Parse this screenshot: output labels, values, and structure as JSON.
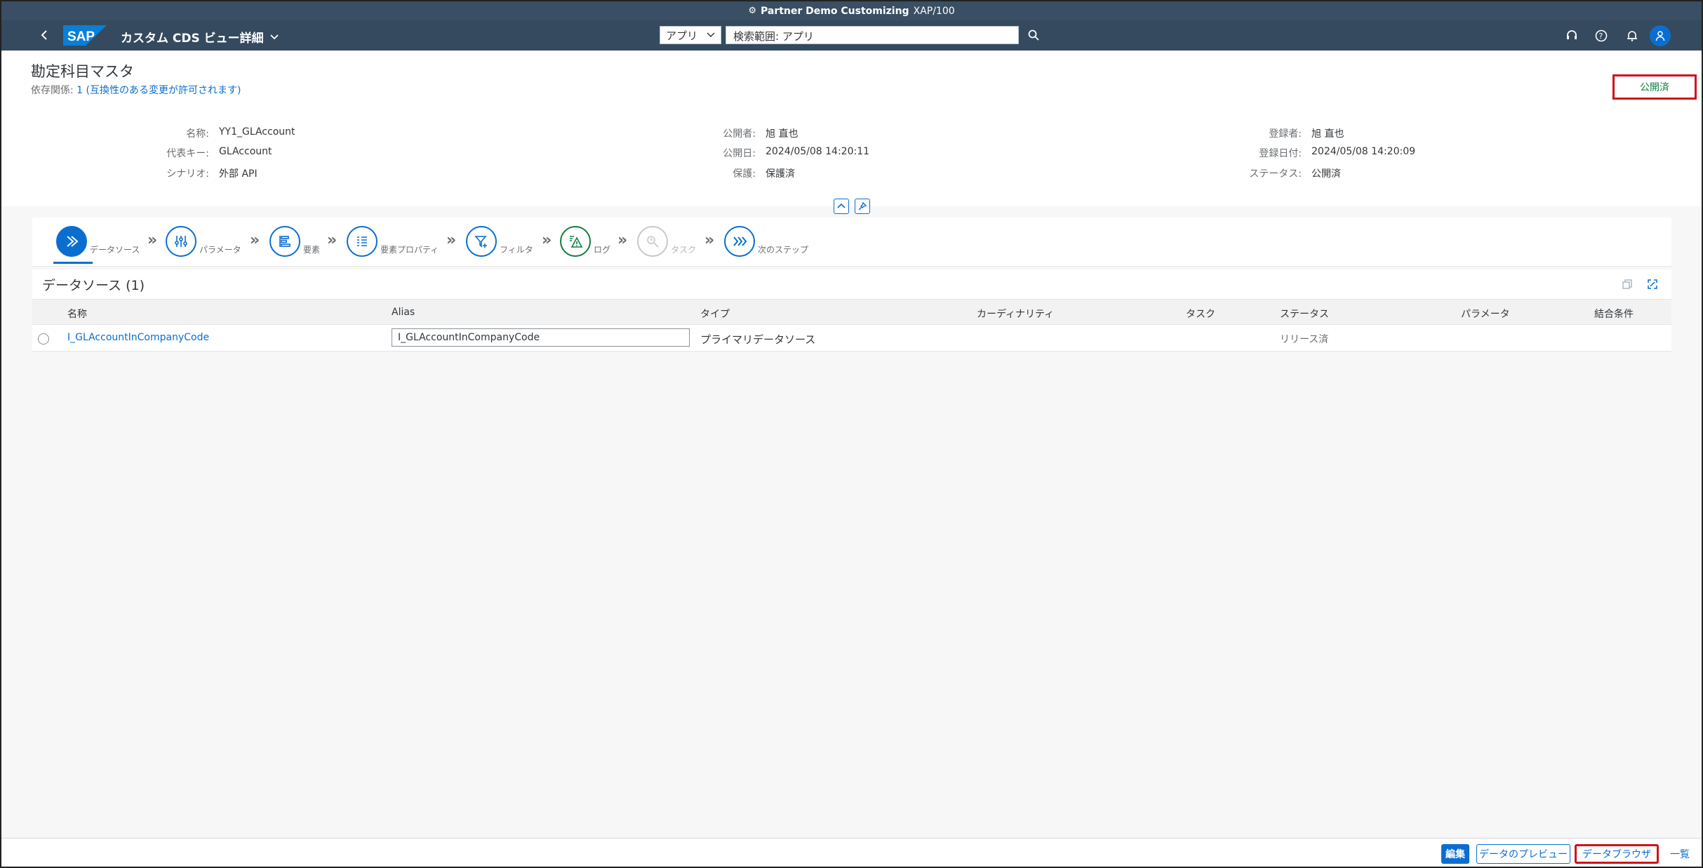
{
  "window": {
    "title_app": "Partner Demo Customizing",
    "title_system": "XAP/100"
  },
  "shell": {
    "back_label": "<",
    "logo": "SAP",
    "title": "カスタム CDS ビュー詳細",
    "scope": "アプリ",
    "search_placeholder": "検索範囲: アプリ"
  },
  "header": {
    "title": "勘定科目マスタ",
    "deps_label": "依存関係:",
    "deps_value": "1 (互換性のある変更が許可されます)",
    "status": "公開済",
    "attributes": {
      "name_label": "名称:",
      "name": "YY1_GLAccount",
      "key_label": "代表キー:",
      "key": "GLAccount",
      "scenario_label": "シナリオ:",
      "scenario": "外部 API",
      "publisher_label": "公開者:",
      "publisher": "旭 直也",
      "pubdate_label": "公開日:",
      "pubdate": "2024/05/08 14:20:11",
      "protection_label": "保護:",
      "protection": "保護済",
      "creator_label": "登録者:",
      "creator": "旭 直也",
      "createdate_label": "登録日付:",
      "createdate": "2024/05/08 14:20:09",
      "status_label": "ステータス:",
      "status_value": "公開済"
    }
  },
  "steps": [
    {
      "label": "データソース",
      "icon": "data-source-icon",
      "state": "active"
    },
    {
      "label": "パラメータ",
      "icon": "parameters-icon",
      "state": "normal"
    },
    {
      "label": "要素",
      "icon": "elements-icon",
      "state": "normal"
    },
    {
      "label": "要素プロパティ",
      "icon": "element-properties-icon",
      "state": "normal"
    },
    {
      "label": "フィルタ",
      "icon": "filter-icon",
      "state": "normal"
    },
    {
      "label": "ログ",
      "icon": "log-warning-icon",
      "state": "green"
    },
    {
      "label": "タスク",
      "icon": "task-icon",
      "state": "disabled"
    },
    {
      "label": "次のステップ",
      "icon": "next-step-icon",
      "state": "normal"
    }
  ],
  "table": {
    "title": "データソース (1)",
    "columns": [
      "名称",
      "Alias",
      "タイプ",
      "カーディナリティ",
      "タスク",
      "ステータス",
      "パラメータ",
      "結合条件"
    ],
    "rows": [
      {
        "name": "I_GLAccountInCompanyCode",
        "alias": "I_GLAccountInCompanyCode",
        "type": "プライマリデータソース",
        "cardinality": "",
        "task": "",
        "status": "リリース済",
        "parameters": "",
        "join": ""
      }
    ]
  },
  "footer": {
    "edit": "編集",
    "preview": "データのプレビュー",
    "browser": "データブラウザ",
    "list": "一覧"
  },
  "colors": {
    "shell": "#354a5f",
    "accent": "#0a6ed1",
    "positive": "#107e3e",
    "highlight": "#d0101a"
  }
}
